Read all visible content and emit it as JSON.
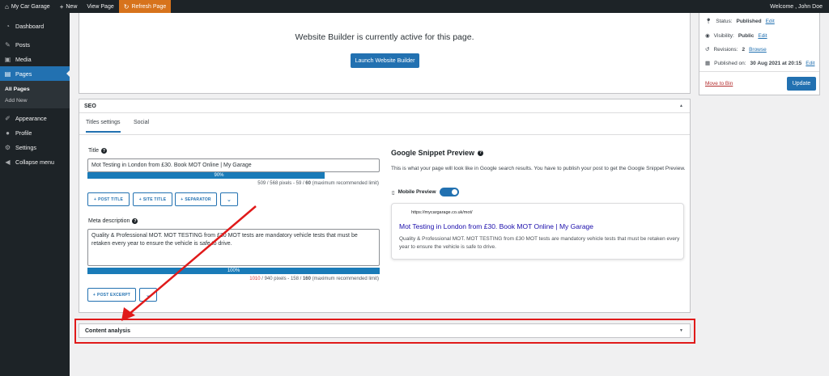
{
  "adminbar": {
    "site_name": "My Car Garage",
    "new_label": "New",
    "view_page": "View Page",
    "refresh_page": "Refresh Page",
    "welcome": "Welcome , John Doe"
  },
  "sidebar": {
    "items": [
      {
        "label": "Dashboard",
        "icon": "dashboard-icon"
      },
      {
        "label": "Posts",
        "icon": "pin-icon"
      },
      {
        "label": "Media",
        "icon": "media-icon"
      },
      {
        "label": "Pages",
        "icon": "pages-icon"
      },
      {
        "label": "Appearance",
        "icon": "brush-icon"
      },
      {
        "label": "Profile",
        "icon": "user-icon"
      },
      {
        "label": "Settings",
        "icon": "settings-icon"
      },
      {
        "label": "Collapse menu",
        "icon": "collapse-icon"
      }
    ],
    "submenu": [
      "All Pages",
      "Add New"
    ]
  },
  "builder": {
    "message": "Website Builder is currently active for this page.",
    "launch_label": "Launch Website Builder"
  },
  "publish": {
    "status_label": "Status:",
    "status_value": "Published",
    "visibility_label": "Visibility:",
    "visibility_value": "Public",
    "revisions_label": "Revisions:",
    "revisions_value": "2",
    "browse": "Browse",
    "published_label": "Published on:",
    "published_value": "30 Aug 2021 at 20:15",
    "edit": "Edit",
    "move_to_bin": "Move to Bin",
    "update": "Update"
  },
  "seo": {
    "header": "SEO",
    "tabs": [
      "Titles settings",
      "Social"
    ],
    "title_label": "Title",
    "title_value": "Mot Testing in London from £30. Book MOT Online | My Garage",
    "title_progress": {
      "percent": 90,
      "label": "90%"
    },
    "title_limit_a": "509",
    "title_limit_b": " / 568 pixels - 59 / ",
    "title_limit_c": "60",
    "title_limit_d": " (maximum recommended limit)",
    "tag_buttons": [
      "POST TITLE",
      "SITE TITLE",
      "SEPARATOR"
    ],
    "meta_label": "Meta description",
    "meta_value": "Quality & Professional MOT. MOT TESTING from £30 MOT tests are mandatory vehicle tests that must be retaken every year to ensure the vehicle is safe to drive.",
    "meta_progress": {
      "percent": 100,
      "label": "100%"
    },
    "meta_limit_a": "1010",
    "meta_limit_b": " / 940 pixels - 158 / ",
    "meta_limit_c": "160",
    "meta_limit_d": " (maximum recommended limit)",
    "excerpt_button": "POST EXCERPT",
    "snippet_title": "Google Snippet Preview",
    "snippet_desc": "This is what your page will look like in Google search results. You have to publish your post to get the Google Snippet Preview.",
    "mobile_preview": "Mobile Preview",
    "card_url": "https://mycargarage.co.uk/mot/",
    "card_title": "Mot Testing in London from £30. Book MOT Online | My Garage",
    "card_desc": "Quality & Professional MOT. MOT TESTING from £30 MOT tests are mandatory vehicle tests that must be retaken every year to ensure the vehicle is safe to drive."
  },
  "content_analysis": {
    "label": "Content analysis"
  },
  "colors": {
    "accent": "#2271b1",
    "highlight": "#e01a1a",
    "refresh": "#d7731c"
  }
}
